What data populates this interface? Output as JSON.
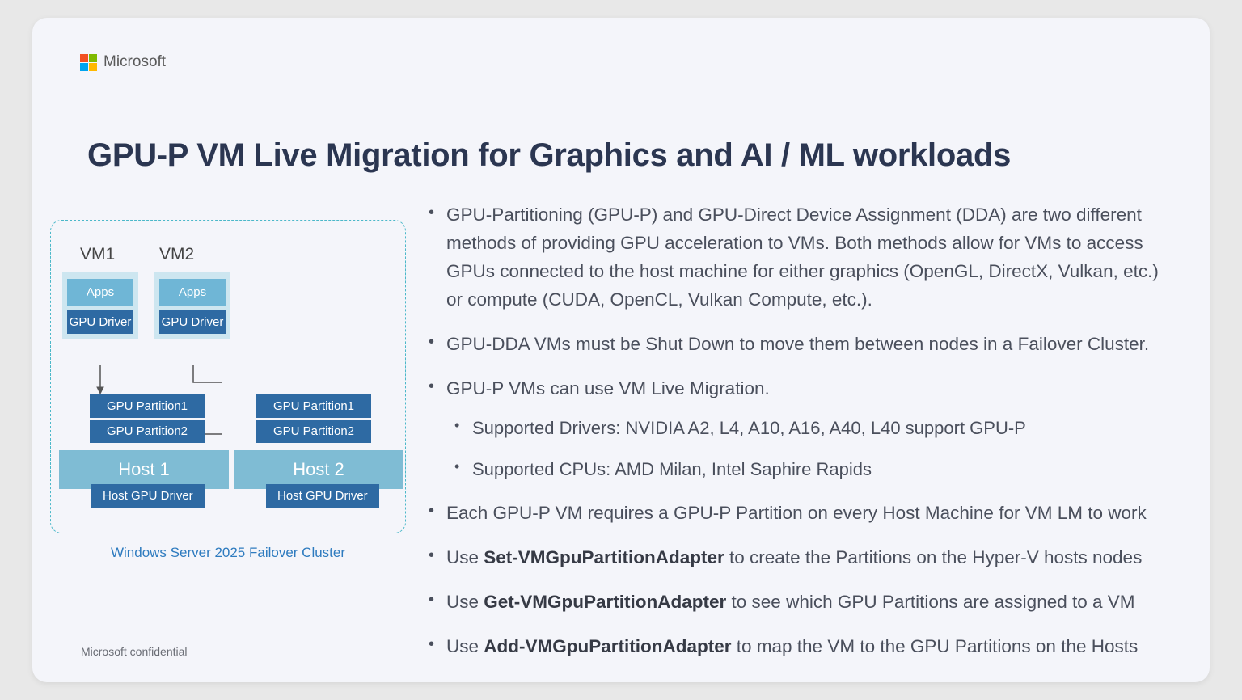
{
  "brand": "Microsoft",
  "title": "GPU-P VM Live Migration for Graphics and AI / ML workloads",
  "diagram": {
    "vm1": "VM1",
    "vm2": "VM2",
    "apps": "Apps",
    "gpu_driver": "GPU Driver",
    "gpu_partition1": "GPU Partition1",
    "gpu_partition2": "GPU Partition2",
    "host1": "Host 1",
    "host2": "Host 2",
    "host_gpu_driver": "Host GPU Driver",
    "caption": "Windows Server 2025 Failover Cluster"
  },
  "bullets": {
    "b1": "GPU-Partitioning (GPU-P) and GPU-Direct Device Assignment (DDA) are two different methods of providing GPU acceleration to VMs. Both methods allow for VMs to access GPUs connected to the host machine for either graphics (OpenGL, DirectX, Vulkan, etc.) or compute (CUDA, OpenCL, Vulkan Compute, etc.).",
    "b2": "GPU-DDA VMs must be Shut Down to move them between nodes in a Failover Cluster.",
    "b3": "GPU-P VMs can use VM Live Migration.",
    "b3_sub1": "Supported Drivers: NVIDIA A2, L4, A10, A16, A40, L40 support GPU-P",
    "b3_sub2": "Supported CPUs: AMD Milan, Intel Saphire Rapids",
    "b4": "Each GPU-P VM requires a GPU-P Partition on every Host Machine for VM LM to work",
    "b5_pre": "Use ",
    "b5_cmd": "Set-VMGpuPartitionAdapter",
    "b5_post": " to create the Partitions on the Hyper-V hosts nodes",
    "b6_pre": "Use ",
    "b6_cmd": "Get-VMGpuPartitionAdapter",
    "b6_post": " to see which GPU Partitions are assigned to a VM",
    "b7_pre": "Use ",
    "b7_cmd": "Add-VMGpuPartitionAdapter",
    "b7_post": " to map the VM to the GPU Partitions on the Hosts"
  },
  "footer": "Microsoft confidential"
}
